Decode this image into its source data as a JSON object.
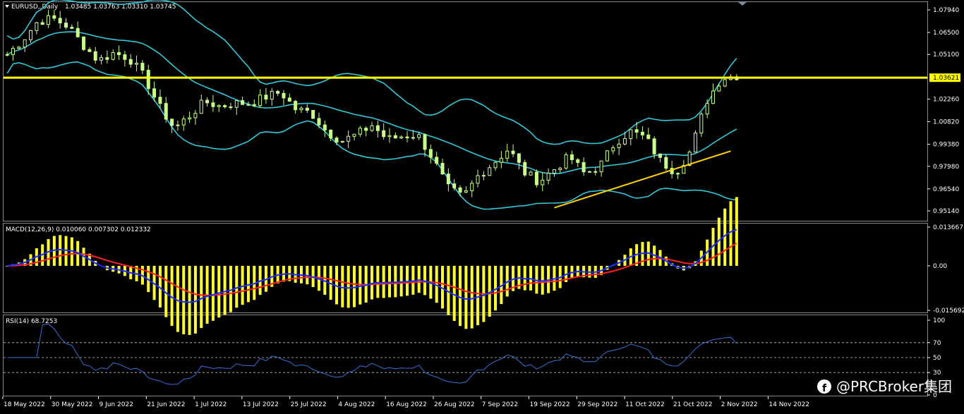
{
  "colors": {
    "background": "#000000",
    "frame": "#8a8a8a",
    "candle": "#c8ff8a",
    "bands": "#32c8d8",
    "hline": "#ffff00",
    "trendline": "#ffd400",
    "macd_hist": "#ffff33",
    "macd_line": "#1e2dff",
    "signal_line": "#ff2020",
    "rsi_line": "#3a6ed8",
    "levels": "#c8c8c8"
  },
  "header": {
    "symbol": "EURUSD,,Daily",
    "ohlc": "1.03485 1.03763 1.03310 1.03745"
  },
  "macd_header": "MACD(12,26,9) 0.010060 0.007302 0.012332",
  "rsi_header": "RSI(14) 68.7253",
  "watermark": "@PRCBroker集团",
  "chart_data": [
    {
      "type": "candlestick",
      "name": "EURUSD Daily",
      "y_ticks": [
        "1.07940",
        "1.06500",
        "1.05100",
        "1.03621",
        "1.02260",
        "1.00820",
        "0.99380",
        "0.97980",
        "0.96540",
        "0.95140"
      ],
      "ylim": [
        0.9514,
        1.0794
      ],
      "current_price": "1.03621",
      "indicators": [
        "Bollinger Bands",
        "horizontal line 1.0362",
        "ascending trendline"
      ],
      "approx_close_path": [
        1.051,
        1.06,
        1.072,
        1.074,
        1.069,
        1.057,
        1.047,
        1.052,
        1.049,
        1.037,
        1.018,
        1.004,
        1.012,
        1.021,
        1.018,
        1.02,
        1.02,
        1.024,
        1.027,
        1.016,
        1.014,
        1.002,
        0.996,
        1.0,
        1.006,
        0.997,
        0.999,
        1.0,
        0.985,
        0.966,
        0.96,
        0.974,
        0.982,
        0.991,
        0.976,
        0.97,
        0.978,
        0.986,
        0.975,
        0.98,
        0.995,
        1.002,
        0.998,
        0.983,
        0.976,
        0.99,
        1.021,
        1.036,
        1.0375
      ]
    },
    {
      "type": "bar+line",
      "name": "MACD(12,26,9)",
      "values": {
        "main": 0.01006,
        "signal": 0.007302,
        "histogram": 0.012332
      },
      "y_ticks": [
        "0.013667",
        "0.00",
        "-0.015692"
      ],
      "ylim": [
        -0.015692,
        0.013667
      ]
    },
    {
      "type": "line",
      "name": "RSI(14)",
      "last_value": 68.7253,
      "y_ticks": [
        "100",
        "70",
        "50",
        "30",
        "0"
      ],
      "levels": [
        70,
        50,
        30
      ],
      "ylim": [
        0,
        100
      ]
    }
  ],
  "x_ticks": [
    "18 May 2022",
    "30 May 2022",
    "9 Jun 2022",
    "21 Jun 2022",
    "1 Jul 2022",
    "13 Jul 2022",
    "25 Jul 2022",
    "4 Aug 2022",
    "16 Aug 2022",
    "26 Aug 2022",
    "7 Sep 2022",
    "19 Sep 2022",
    "29 Sep 2022",
    "11 Oct 2022",
    "21 Oct 2022",
    "2 Nov 2022",
    "14 Nov 2022"
  ]
}
